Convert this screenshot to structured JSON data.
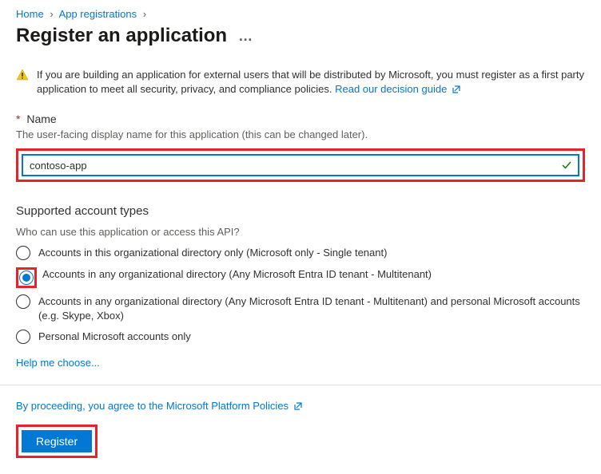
{
  "breadcrumb": {
    "home": "Home",
    "appreg": "App registrations"
  },
  "page_title": "Register an application",
  "warning": {
    "text": "If you are building an application for external users that will be distributed by Microsoft, you must register as a first party application to meet all security, privacy, and compliance policies. ",
    "link": "Read our decision guide"
  },
  "name_field": {
    "label": "Name",
    "help": "The user-facing display name for this application (this can be changed later).",
    "value": "contoso-app"
  },
  "account_types": {
    "heading": "Supported account types",
    "question": "Who can use this application or access this API?",
    "options": [
      "Accounts in this organizational directory only (Microsoft only - Single tenant)",
      "Accounts in any organizational directory (Any Microsoft Entra ID tenant - Multitenant)",
      "Accounts in any organizational directory (Any Microsoft Entra ID tenant - Multitenant) and personal Microsoft accounts (e.g. Skype, Xbox)",
      "Personal Microsoft accounts only"
    ],
    "help_link": "Help me choose..."
  },
  "footer": {
    "policy_text": "By proceeding, you agree to the Microsoft Platform Policies",
    "register": "Register"
  }
}
